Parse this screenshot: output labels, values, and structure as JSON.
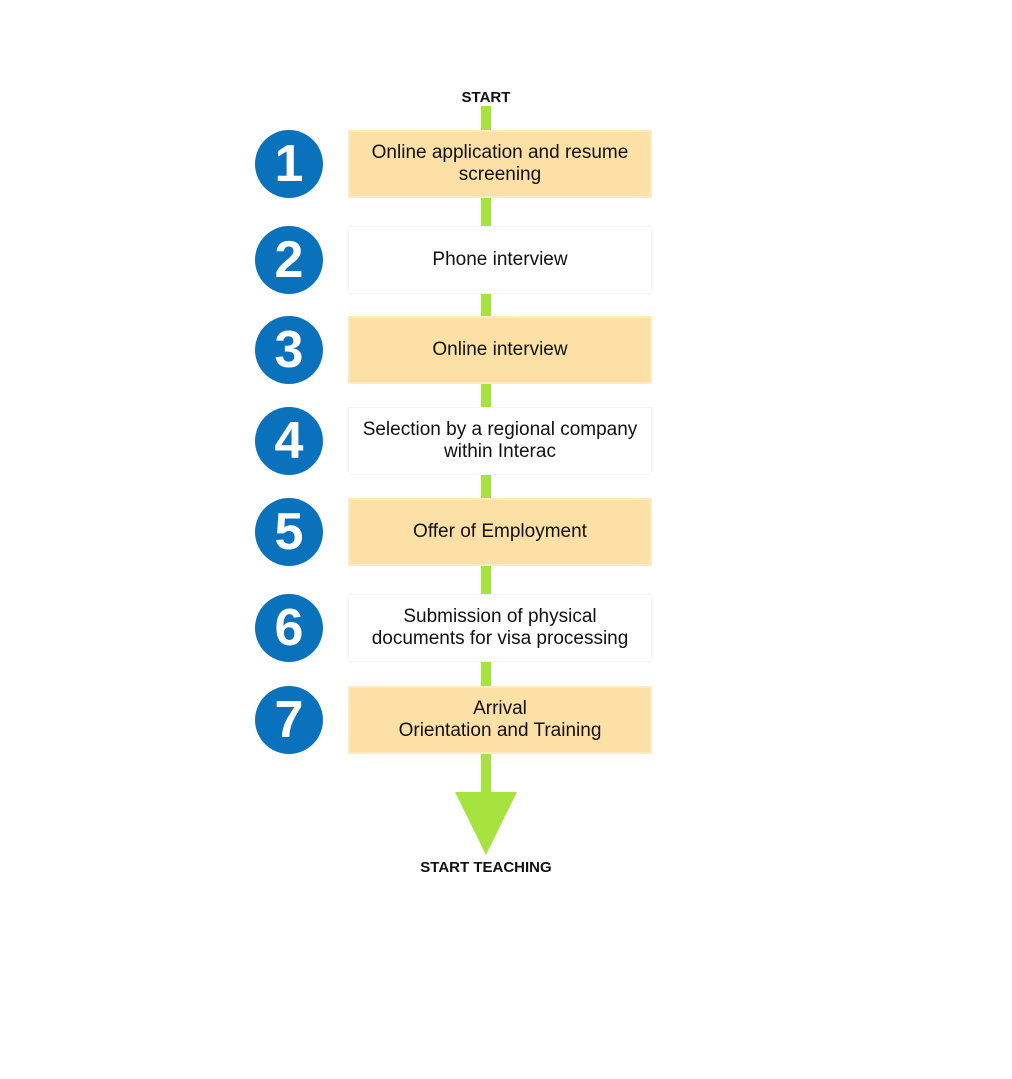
{
  "start_label": "START",
  "end_label": "START TEACHING",
  "colors": {
    "connector": "#A6E33F",
    "step_number": "#0A72BD",
    "highlight_box": "#FDE0A6"
  },
  "steps": [
    {
      "number": "1",
      "text": "Online application and resume\nscreening",
      "highlighted": true
    },
    {
      "number": "2",
      "text": "Phone interview",
      "highlighted": false
    },
    {
      "number": "3",
      "text": "Online interview",
      "highlighted": true
    },
    {
      "number": "4",
      "text": "Selection by a regional company\nwithin Interac",
      "highlighted": false
    },
    {
      "number": "5",
      "text": "Offer of Employment",
      "highlighted": true
    },
    {
      "number": "6",
      "text": "Submission of physical\ndocuments for visa processing",
      "highlighted": false
    },
    {
      "number": "7",
      "text": "Arrival\nOrientation and Training",
      "highlighted": true
    }
  ]
}
